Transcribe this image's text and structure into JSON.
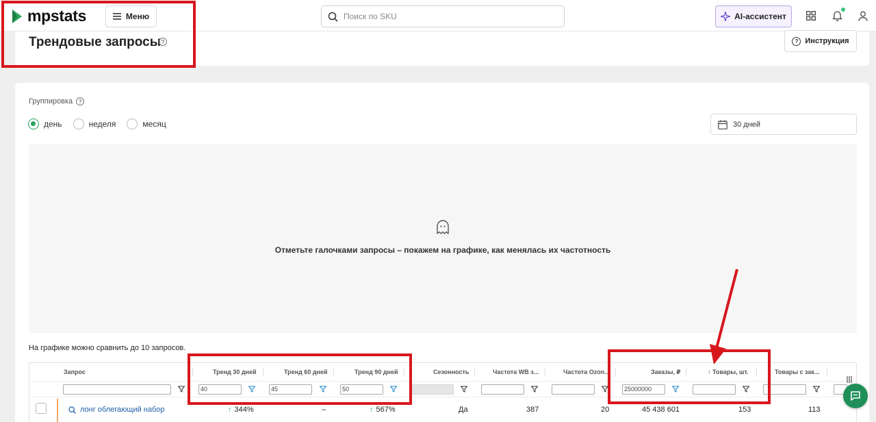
{
  "app": {
    "logo_text": "mpstats"
  },
  "topbar": {
    "menu_label": "Меню",
    "search_placeholder": "Поиск по SKU",
    "ai_label": "AI-ассистент"
  },
  "header": {
    "title": "Трендовые запросы",
    "instruction_label": "Инструкция"
  },
  "grouping": {
    "label": "Группировка",
    "options": [
      "день",
      "неделя",
      "месяц"
    ],
    "selected": "день",
    "period_label": "30 дней"
  },
  "chart": {
    "empty_message": "Отметьте галочками запросы – покажем на графике, как менялась их частотность",
    "compare_note": "На графике можно сравнить до 10 запросов."
  },
  "table": {
    "columns": [
      "Запрос",
      "Тренд 30 дней",
      "Тренд 60 дней",
      "Тренд 90 дней",
      "Сезонность",
      "Частота WB з...",
      "Частота Ozon...",
      "Заказы, ₽",
      "↑ Товары, шт.",
      "Товары с зак..."
    ],
    "filters": {
      "query": "",
      "trend30": "40",
      "trend60": "45",
      "trend90": "50",
      "orders": "25000000"
    },
    "rows": [
      {
        "query": "лонг облегающий набор",
        "trend30": "344%",
        "trend60": "–",
        "trend90": "567%",
        "seasonality": "Да",
        "wb_freq": "387",
        "ozon_freq": "20",
        "orders": "45 438 601",
        "goods": "153",
        "goods_with_orders": "113"
      }
    ]
  },
  "colors": {
    "accent_green": "#2aa55b",
    "annotation_red": "#d8171d",
    "link_blue": "#1f5fa8"
  },
  "icons": [
    "logo-icon",
    "menu-icon",
    "search-icon",
    "sparkle-icon",
    "grid-icon",
    "bell-icon",
    "user-icon",
    "help-icon",
    "calendar-icon",
    "ghost-icon",
    "filter-icon",
    "chat-icon"
  ]
}
